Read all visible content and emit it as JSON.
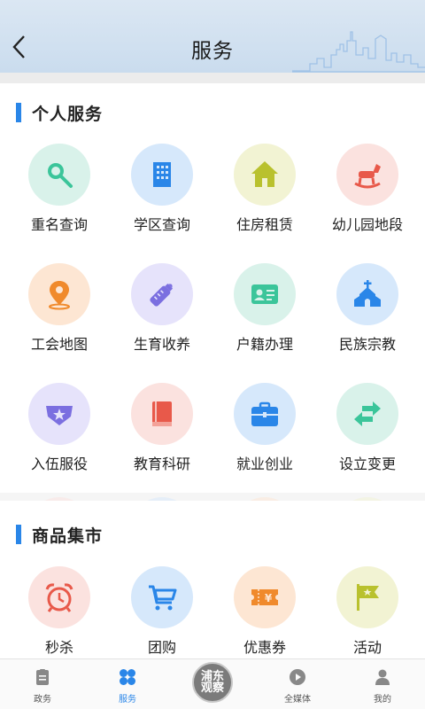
{
  "header": {
    "title": "服务"
  },
  "sections": [
    {
      "title": "个人服务",
      "items": [
        {
          "label": "重名查询",
          "icon": "magnifier-icon",
          "bg": "#d9f2ea"
        },
        {
          "label": "学区查询",
          "icon": "building-icon",
          "bg": "#d6e8fb"
        },
        {
          "label": "住房租赁",
          "icon": "house-icon",
          "bg": "#f2f3d3"
        },
        {
          "label": "幼儿园地段",
          "icon": "rocking-horse-icon",
          "bg": "#fbe2df"
        },
        {
          "label": "工会地图",
          "icon": "location-pin-icon",
          "bg": "#fde6d3"
        },
        {
          "label": "生育收养",
          "icon": "baby-bottle-icon",
          "bg": "#e6e3fb"
        },
        {
          "label": "户籍办理",
          "icon": "id-card-icon",
          "bg": "#d9f2ea"
        },
        {
          "label": "民族宗教",
          "icon": "church-icon",
          "bg": "#d6e8fb"
        },
        {
          "label": "入伍服役",
          "icon": "military-badge-icon",
          "bg": "#e6e3fb"
        },
        {
          "label": "教育科研",
          "icon": "book-icon",
          "bg": "#fbe2df"
        },
        {
          "label": "就业创业",
          "icon": "briefcase-icon",
          "bg": "#d6e8fb"
        },
        {
          "label": "设立变更",
          "icon": "swap-arrows-icon",
          "bg": "#d9f2ea"
        }
      ]
    },
    {
      "title": "商品集市",
      "items": [
        {
          "label": "秒杀",
          "icon": "alarm-clock-icon",
          "bg": "#fbe2df"
        },
        {
          "label": "团购",
          "icon": "shopping-cart-icon",
          "bg": "#d6e8fb"
        },
        {
          "label": "优惠券",
          "icon": "coupon-icon",
          "bg": "#fde6d3"
        },
        {
          "label": "活动",
          "icon": "flag-icon",
          "bg": "#f2f3d3"
        }
      ]
    }
  ],
  "tabbar": {
    "tabs": [
      {
        "label": "政务",
        "icon": "clipboard-icon",
        "active": false
      },
      {
        "label": "服务",
        "icon": "four-petal-icon",
        "active": true
      },
      {
        "label": "全媒体",
        "icon": "play-circle-icon",
        "active": false
      },
      {
        "label": "我的",
        "icon": "person-icon",
        "active": false
      }
    ],
    "center_logo_text": "浦东观察"
  },
  "colors": {
    "accent": "#2a86e8",
    "header_bg": "#d3e2f1"
  }
}
